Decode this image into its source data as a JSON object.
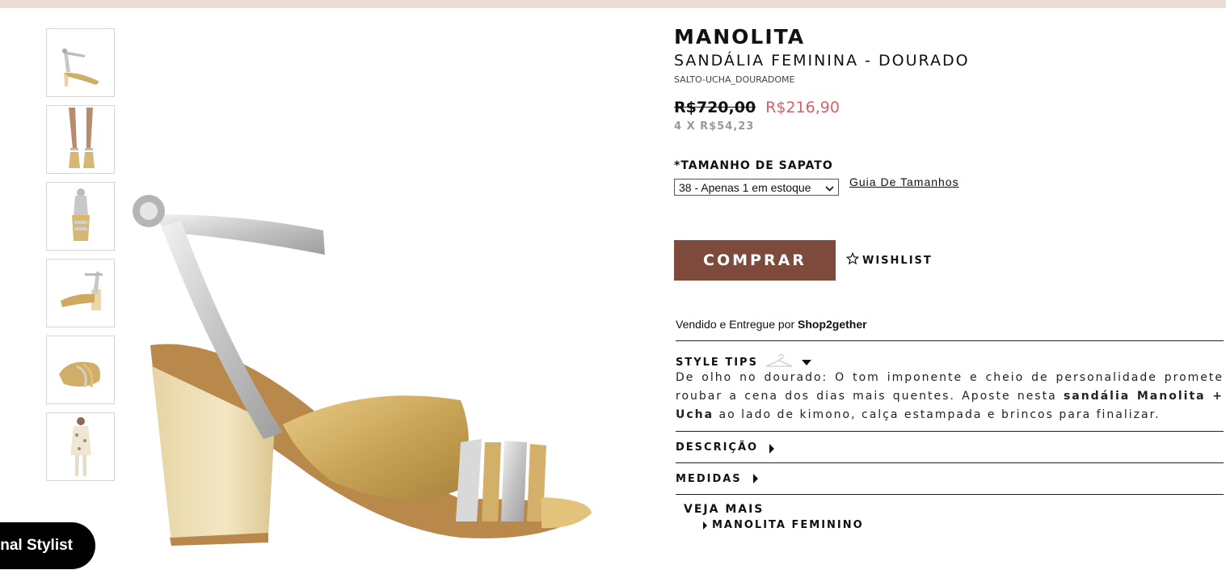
{
  "product": {
    "brand": "MANOLITA",
    "name": "SANDÁLIA FEMININA - DOURADO",
    "sku": "SALTO-UCHA_DOURADOME",
    "old_price": "R$720,00",
    "new_price": "R$216,90",
    "installments": "4 X R$54,23"
  },
  "size": {
    "label": "*TAMANHO DE SAPATO",
    "selected": "38 - Apenas 1 em estoque",
    "guide_link": "Guia De Tamanhos"
  },
  "actions": {
    "buy_label": "COMPRAR",
    "wishlist_label": "WISHLIST"
  },
  "seller": {
    "prefix": "Vendido e Entregue por",
    "name": "Shop2gether"
  },
  "style_tips": {
    "title": "STYLE TIPS",
    "text_1": "De olho no dourado: O tom imponente e cheio de personalidade promete roubar a cena dos dias mais quentes. Aposte nesta",
    "bold": "sandália Manolita + Ucha",
    "text_2": "ao lado de kimono, calça estampada e brincos para finalizar."
  },
  "sections": {
    "description": "DESCRIÇÃO",
    "measures": "MEDIDAS"
  },
  "see_more": {
    "title": "VEJA MAIS",
    "link": "MANOLITA FEMININO"
  },
  "stylist_button": "nal Stylist",
  "colors": {
    "buy_button": "#7d4a3c",
    "sale_price": "#d4606a",
    "top_bar": "#ecdcd6"
  }
}
